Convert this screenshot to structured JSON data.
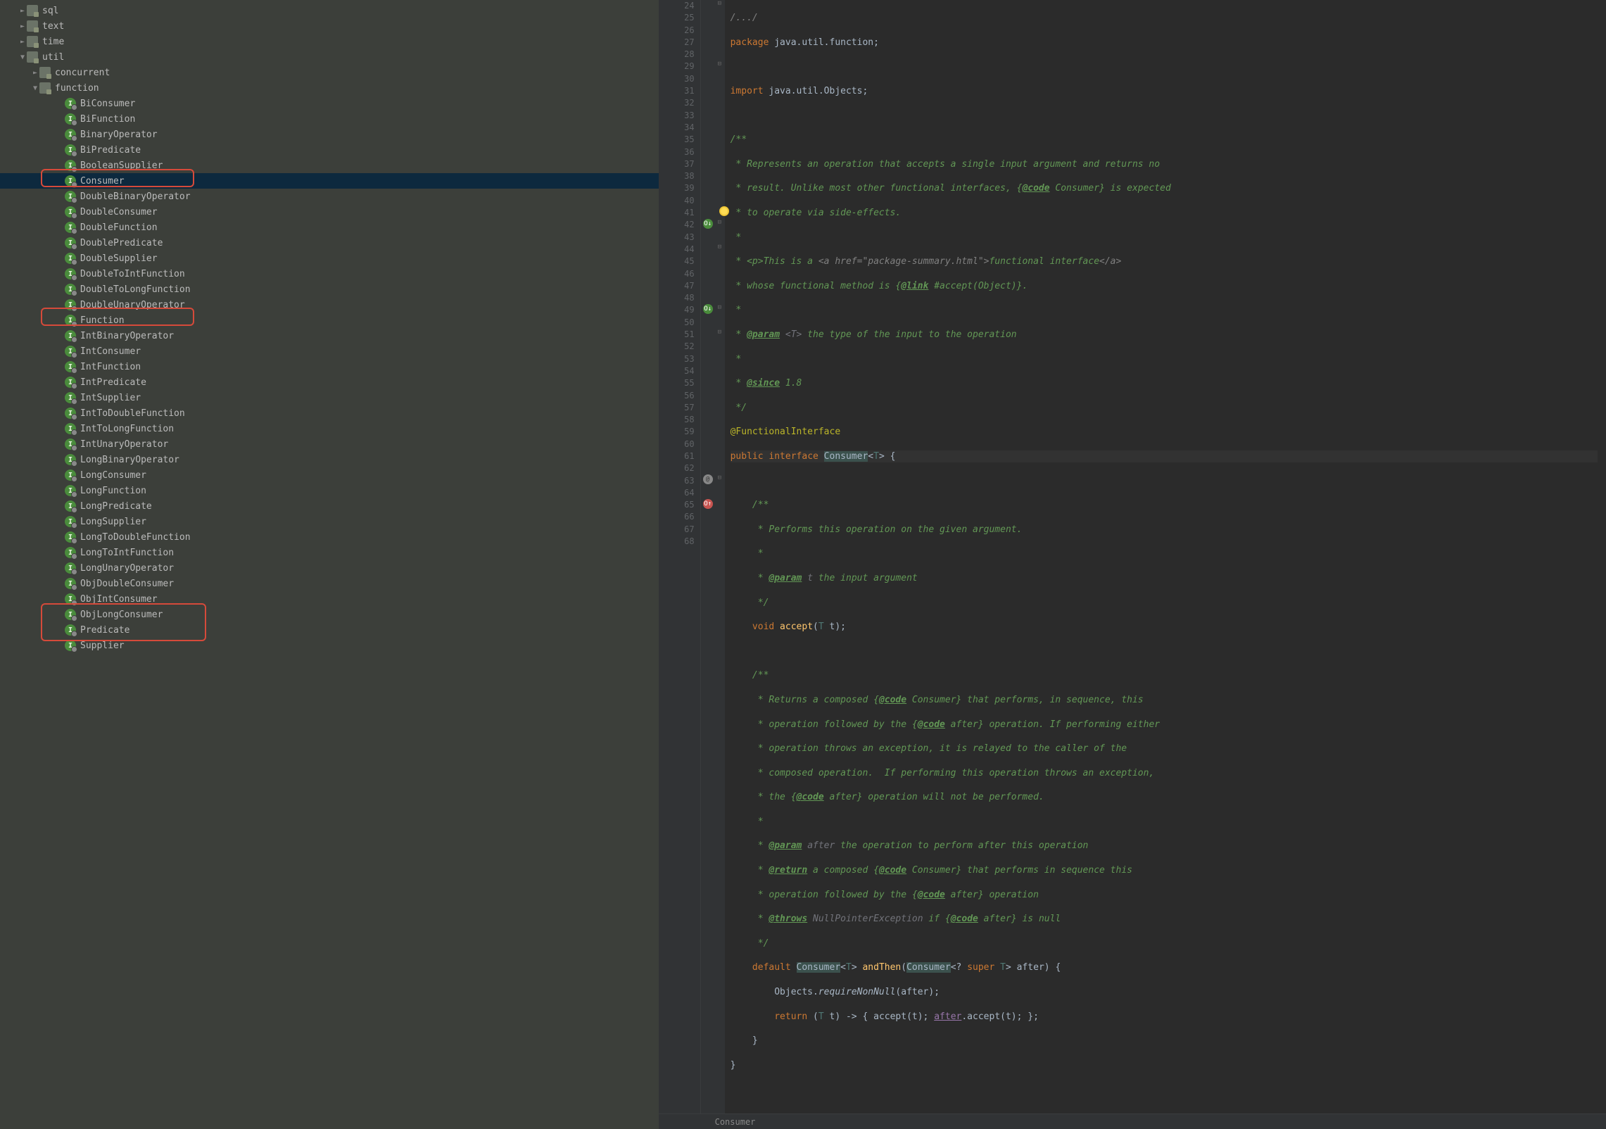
{
  "tree": {
    "top": [
      {
        "label": "sql",
        "depth": 1,
        "arrow": "►",
        "kind": "folder"
      },
      {
        "label": "text",
        "depth": 1,
        "arrow": "►",
        "kind": "folder"
      },
      {
        "label": "time",
        "depth": 1,
        "arrow": "►",
        "kind": "folder"
      },
      {
        "label": "util",
        "depth": 1,
        "arrow": "▼",
        "kind": "folder"
      },
      {
        "label": "concurrent",
        "depth": 2,
        "arrow": "►",
        "kind": "folder"
      },
      {
        "label": "function",
        "depth": 2,
        "arrow": "▼",
        "kind": "folder"
      }
    ],
    "interfaces": [
      "BiConsumer",
      "BiFunction",
      "BinaryOperator",
      "BiPredicate",
      "BooleanSupplier",
      "Consumer",
      "DoubleBinaryOperator",
      "DoubleConsumer",
      "DoubleFunction",
      "DoublePredicate",
      "DoubleSupplier",
      "DoubleToIntFunction",
      "DoubleToLongFunction",
      "DoubleUnaryOperator",
      "Function",
      "IntBinaryOperator",
      "IntConsumer",
      "IntFunction",
      "IntPredicate",
      "IntSupplier",
      "IntToDoubleFunction",
      "IntToLongFunction",
      "IntUnaryOperator",
      "LongBinaryOperator",
      "LongConsumer",
      "LongFunction",
      "LongPredicate",
      "LongSupplier",
      "LongToDoubleFunction",
      "LongToIntFunction",
      "LongUnaryOperator",
      "ObjDoubleConsumer",
      "ObjIntConsumer",
      "ObjLongConsumer",
      "Predicate",
      "Supplier"
    ],
    "selected": "Consumer"
  },
  "lineNumbers": {
    "start": 24,
    "end": 68
  },
  "breadcrumb": "Consumer",
  "code": {
    "l24": "/.../",
    "l25_pkg": "package",
    "l25_body": " java.util.function;",
    "l27_imp": "import",
    "l27_body": " java.util.Objects;",
    "l29": "/**",
    "l30": " * Represents an operation that accepts a single input argument and returns no",
    "l31a": " * result. Unlike most other functional interfaces, {",
    "l31b": "@code",
    "l31c": " Consumer} is expected",
    "l32": " * to operate via side-effects.",
    "l33": " *",
    "l34a": " * <p>This is a ",
    "l34b": "<a href=\"package-summary.html\">",
    "l34c": "functional interface",
    "l34d": "</a>",
    "l35a": " * whose functional method is {",
    "l35b": "@link",
    "l35c": " #accept(Object)}",
    "l35d": ".",
    "l36": " *",
    "l37a": " * ",
    "l37b": "@param",
    "l37c": " <T>",
    "l37d": " the type of the input to the operation",
    "l38": " *",
    "l39a": " * ",
    "l39b": "@since",
    "l39c": " 1.8",
    "l40": " */",
    "l41": "@FunctionalInterface",
    "l42_public": "public",
    "l42_interface": " interface ",
    "l42_name": "Consumer",
    "l42_g1": "<",
    "l42_T": "T",
    "l42_g2": "> {",
    "l44": "    /**",
    "l45": "     * Performs this operation on the given argument.",
    "l46": "     *",
    "l47a": "     * ",
    "l47b": "@param",
    "l47c": " t",
    "l47d": " the input argument",
    "l48": "     */",
    "l49_void": "    void",
    "l49_name": " accept",
    "l49_p1": "(",
    "l49_T": "T",
    "l49_p2": " t);",
    "l51": "    /**",
    "l52a": "     * Returns a composed {",
    "l52b": "@code",
    "l52c": " Consumer} that performs, in sequence, this",
    "l53a": "     * operation followed by the {",
    "l53b": "@code",
    "l53c": " after} operation. If performing either",
    "l54": "     * operation throws an exception, it is relayed to the caller of the",
    "l55": "     * composed operation.  If performing this operation throws an exception,",
    "l56a": "     * the {",
    "l56b": "@code",
    "l56c": " after} operation will not be performed.",
    "l57": "     *",
    "l58a": "     * ",
    "l58b": "@param",
    "l58c": " after",
    "l58d": " the operation to perform after this operation",
    "l59a": "     * ",
    "l59b": "@return",
    "l59c": " a composed {",
    "l59d": "@code",
    "l59e": " Consumer} that performs in sequence this",
    "l60a": "     * operation followed by the {",
    "l60b": "@code",
    "l60c": " after} operation",
    "l61a": "     * ",
    "l61b": "@throws",
    "l61c": " NullPointerException",
    "l61d": " if {",
    "l61e": "@code",
    "l61f": " after} is null",
    "l62": "     */",
    "l63_default": "    default ",
    "l63_ret": "Consumer",
    "l63_g1": "<",
    "l63_T": "T",
    "l63_g2": "> ",
    "l63_name": "andThen",
    "l63_p1": "(",
    "l63_ptype": "Consumer",
    "l63_p2": "<? ",
    "l63_super": "super ",
    "l63_T2": "T",
    "l63_p3": "> after) {",
    "l64a": "        Objects.",
    "l64b": "requireNonNull",
    "l64c": "(after);",
    "l65a": "        return ",
    "l65b": "(",
    "l65T": "T",
    "l65c": " t) -> { accept(t); ",
    "l65d": "after",
    "l65e": ".accept(t); };",
    "l66": "    }",
    "l67": "}"
  }
}
